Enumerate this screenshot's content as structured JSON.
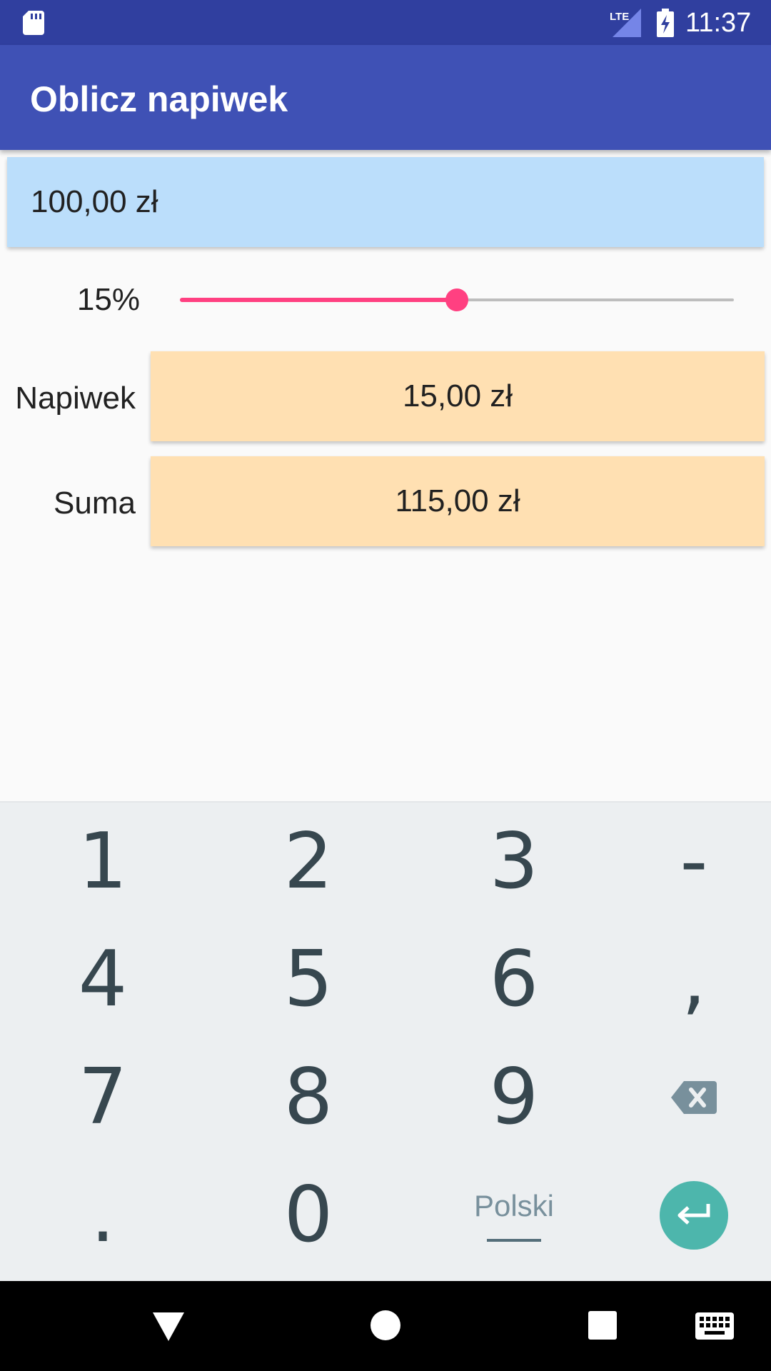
{
  "status_bar": {
    "time": "11:37",
    "network_label": "LTE",
    "icons": [
      "sd-card-icon",
      "lte-signal-icon",
      "battery-charging-icon"
    ]
  },
  "app_bar": {
    "title": "Oblicz napiwek"
  },
  "amount": {
    "value": "100,00 zł"
  },
  "tip_percent": {
    "label": "15%",
    "slider_fraction": 0.5
  },
  "results": {
    "tip_label": "Napiwek",
    "tip_value": "15,00 zł",
    "total_label": "Suma",
    "total_value": "115,00 zł"
  },
  "keyboard": {
    "keys": [
      "1",
      "2",
      "3",
      "-",
      "4",
      "5",
      "6",
      ",",
      "7",
      "8",
      "9",
      ".",
      "0"
    ],
    "language": "Polski",
    "icons": [
      "backspace-icon",
      "enter-icon"
    ]
  },
  "nav_bar": {
    "icons": [
      "back-icon",
      "home-icon",
      "recents-icon",
      "keyboard-switch-icon"
    ]
  },
  "colors": {
    "status_bar": "#303F9F",
    "app_bar": "#3F51B5",
    "amount_bg": "#BBDEFB",
    "result_bg": "#FFE0B2",
    "accent": "#FF4081",
    "enter_key": "#4DB6AC",
    "keyboard_bg": "#ECEFF1"
  }
}
